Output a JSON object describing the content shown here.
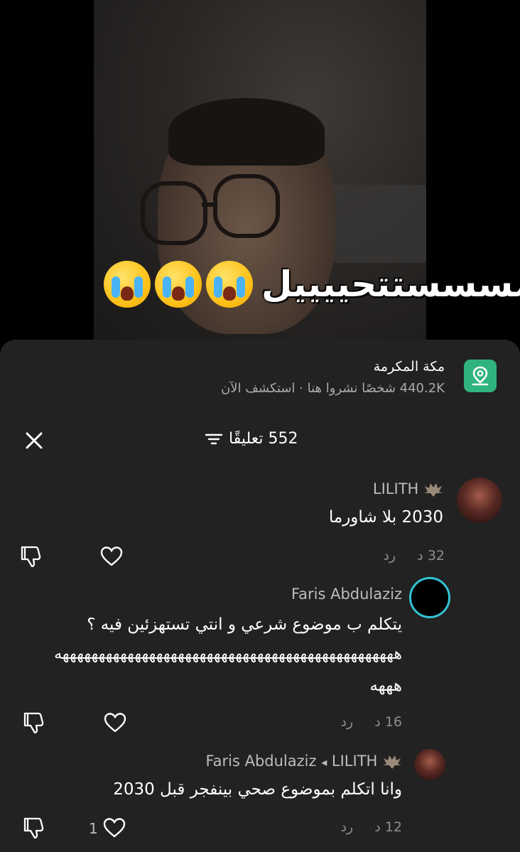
{
  "video": {
    "caption_text": "مسسستتحييييل",
    "caption_emojis": [
      "loudly-crying-face",
      "loudly-crying-face",
      "loudly-crying-face"
    ]
  },
  "location": {
    "title": "مكة المكرمة",
    "subtitle": "440.2K شخصًا نشروا هنا · استكشف الآن",
    "icon": "location-pin-icon",
    "icon_color": "#2fb37f"
  },
  "comments_header": {
    "count_label": "552 تعليقًا",
    "close_icon": "close-icon",
    "sort_icon": "sort-icon"
  },
  "comments": [
    {
      "username": "LILITH",
      "username_suffix_icon": "bat-icon",
      "text": "2030 بلا شاورما",
      "time": "32 د",
      "reply_label": "رد",
      "like_count": ""
    },
    {
      "username": "Faris Abdulaziz",
      "text_line1": "يتكلم ب موضوع شرعي و انتي تستهزئين فيه ؟",
      "text_line2": "هههههههههههههههههههههههههههههههههههههههههههههههه",
      "text_line3": "هههه",
      "time": "16 د",
      "reply_label": "رد",
      "like_count": ""
    },
    {
      "username": "LILITH",
      "reply_to": "Faris Abdulaziz",
      "reply_arrow": "◂",
      "text": "وانا اتكلم بموضوع صحي بينفجر قبل 2030",
      "time": "12 د",
      "reply_label": "رد",
      "like_count": "1"
    }
  ],
  "colors": {
    "sheet_bg": "#222222",
    "accent_ring": "#33c3d6",
    "secondary_text": "#8e8e8e"
  }
}
